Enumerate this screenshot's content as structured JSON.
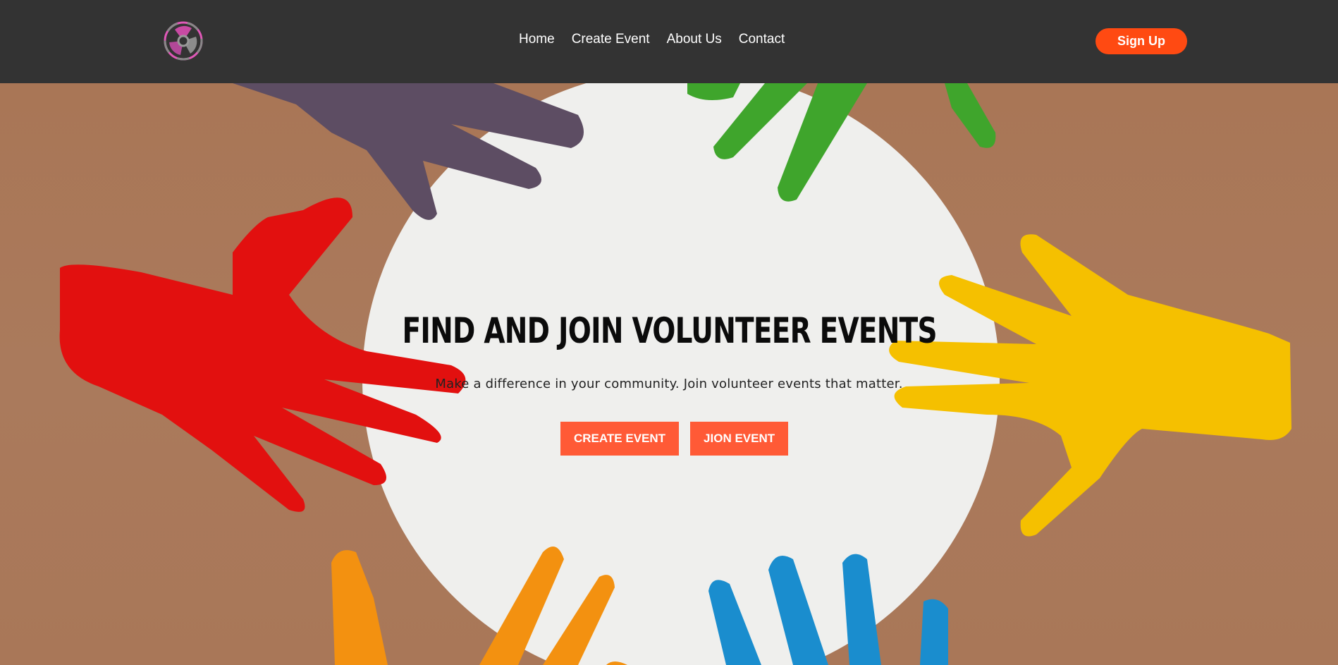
{
  "nav": {
    "logo_icon": "volunteer-wheel-logo",
    "links": [
      {
        "label": "Home"
      },
      {
        "label": "Create Event"
      },
      {
        "label": "About Us"
      },
      {
        "label": "Contact"
      }
    ],
    "signup_label": "Sign Up"
  },
  "hero": {
    "title": "FIND AND JOIN VOLUNTEER EVENTS",
    "subtitle": "Make a difference in your community. Join volunteer events that matter.",
    "create_button": "CREATE EVENT",
    "join_button": "JION EVENT",
    "hand_colors": [
      "#5d4d63",
      "#e2100f",
      "#3fa52c",
      "#f5c000",
      "#f39110",
      "#1a8dce"
    ]
  },
  "colors": {
    "navbar_bg": "#333333",
    "accent": "#ff4a12",
    "button": "#ff5a36",
    "backdrop": "#a97656",
    "circle": "#efefed"
  }
}
